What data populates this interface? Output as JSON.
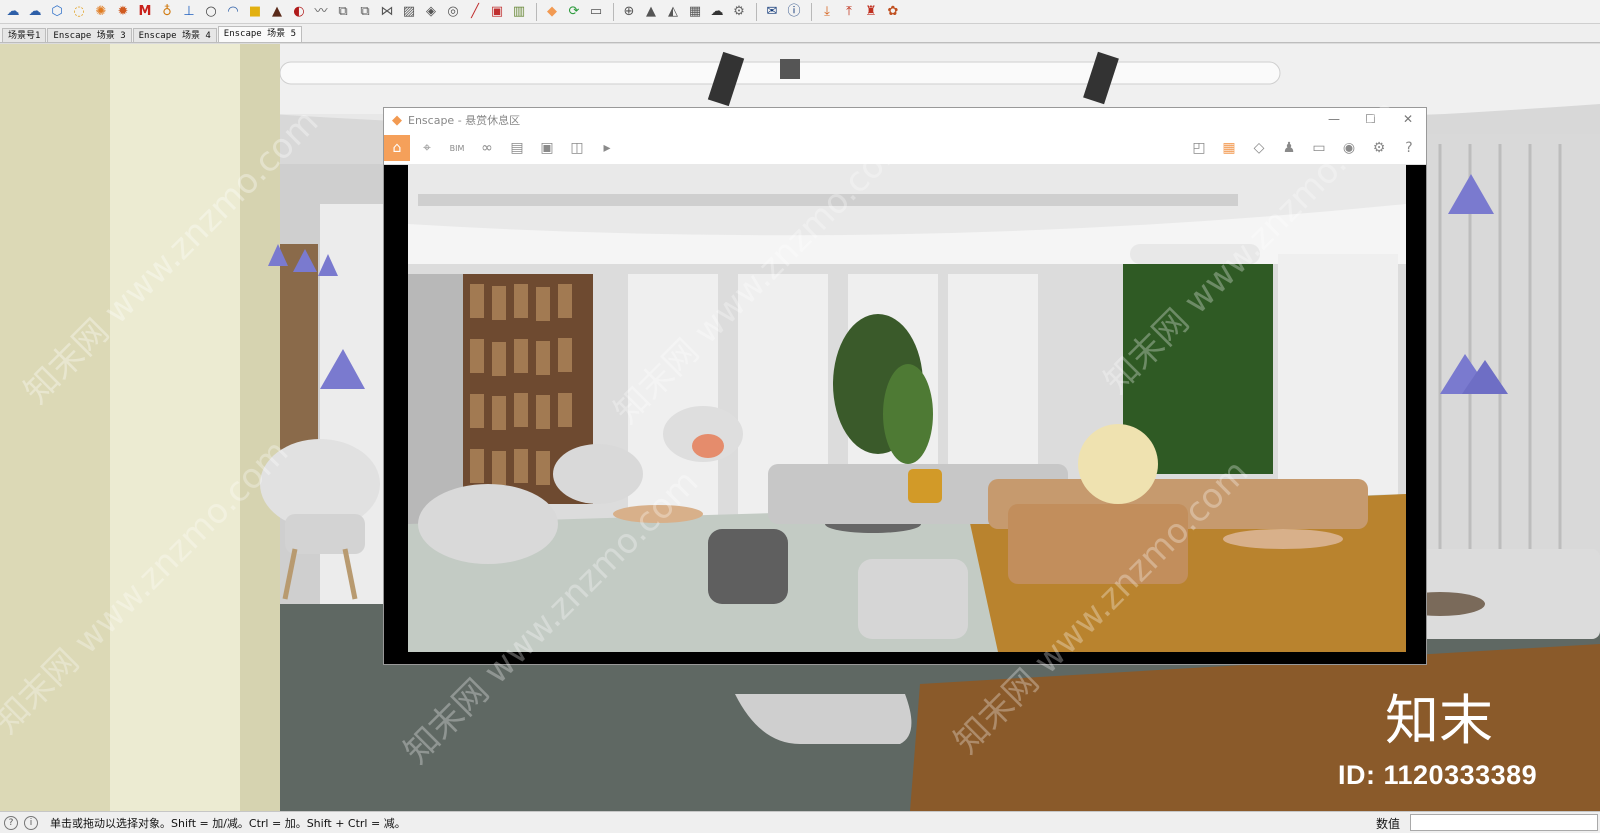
{
  "toolbar": {
    "icons": [
      "orbit-icon",
      "pan-icon",
      "zoom-icon",
      "bulb-icon",
      "sun-icon",
      "gear-sun-icon",
      "m-icon",
      "paint-icon",
      "figure-icon",
      "circle-icon",
      "arc-icon",
      "box-yellow-icon",
      "box-dark-icon",
      "swirl-icon",
      "wave-icon",
      "copy-icon",
      "layers-icon",
      "mirror-icon",
      "panel-icon",
      "diamond-icon",
      "ring-icon",
      "slash-icon",
      "image-icon",
      "bucket-icon",
      "enscape-icon",
      "refresh-icon",
      "window-icon",
      "plus-circle-icon",
      "tree-icon",
      "terrain-icon",
      "checker-icon",
      "cloud-icon",
      "gear-icon",
      "mail-icon",
      "info-icon",
      "download-icon",
      "upload-icon",
      "stamp-icon",
      "settings-icon"
    ]
  },
  "scene_tabs": [
    {
      "label": "场景号1"
    },
    {
      "label": "Enscape 场景 3"
    },
    {
      "label": "Enscape 场景 4"
    },
    {
      "label": "Enscape 场景 5",
      "active": true
    }
  ],
  "enscape": {
    "title": "Enscape - 悬赏休息区",
    "toolbar_labels": [
      "BIM"
    ]
  },
  "status": {
    "message": "单击或拖动以选择对象。Shift = 加/减。Ctrl = 加。Shift + Ctrl = 减。",
    "measure_label": "数值",
    "measure_value": ""
  },
  "watermark": {
    "brand": "知末",
    "id": "ID: 1120333389",
    "diagonal": "知末网 www.znzmo.com"
  },
  "colors": {
    "accent_orange": "#f29a52",
    "toolbar_bg": "#f2f2f2"
  }
}
